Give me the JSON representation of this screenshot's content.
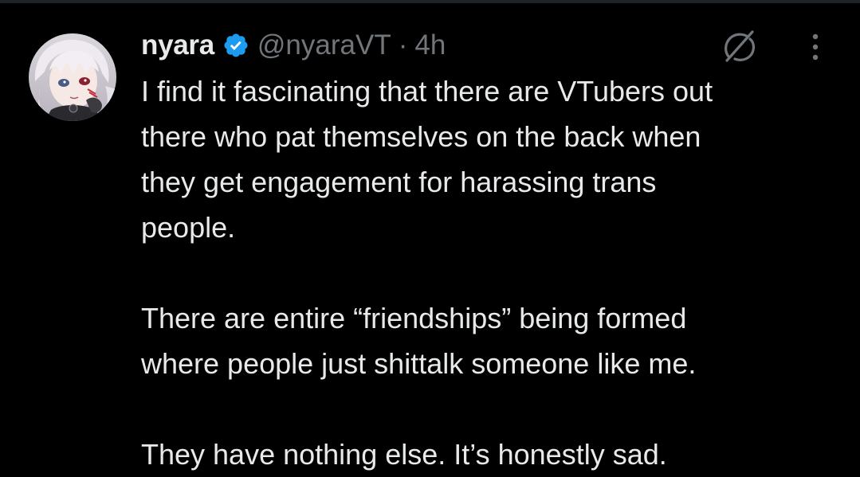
{
  "post": {
    "author_name": "nyara",
    "handle": "@nyaraVT",
    "separator": "·",
    "timestamp": "4h",
    "paragraphs": [
      [
        "I find it fascinating that there are VTubers out",
        "there who pat themselves on the back when",
        "they get engagement for harassing trans",
        "people."
      ],
      [
        "There are entire “friendships” being formed",
        "where people just shittalk someone like me."
      ],
      [
        "They have nothing else. It’s honestly sad."
      ]
    ]
  },
  "icons": {
    "verified": "verified-badge-icon",
    "grok": "grok-icon",
    "more": "more-options-icon",
    "avatar": "profile-avatar"
  },
  "colors": {
    "background": "#000000",
    "text": "#e7e9ea",
    "secondary_text": "#71767b",
    "verified_blue": "#1d9bf0"
  }
}
